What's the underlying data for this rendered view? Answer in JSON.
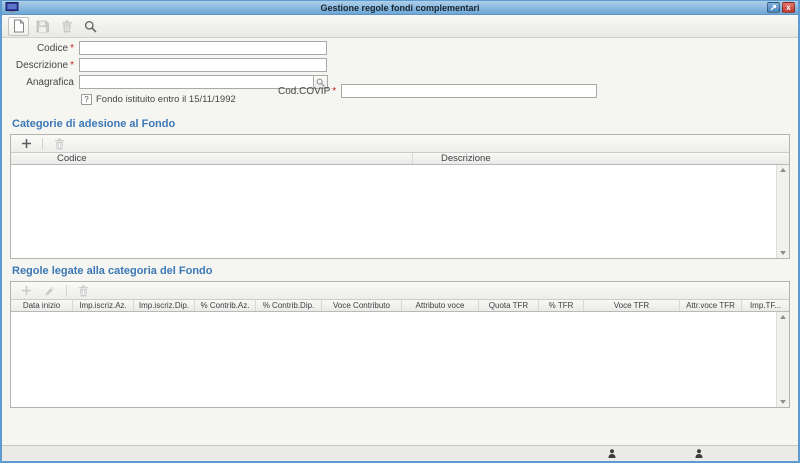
{
  "colors": {
    "accent_blue": "#3c78b4",
    "required_red": "#cc2222",
    "titlebar_blue": "#6ea6d6",
    "window_border": "#5e9bd1"
  },
  "window": {
    "title": "Gestione regole fondi complementari",
    "icon": "application-monitor-icon",
    "buttons": [
      "restore-window-icon",
      "close-window-icon"
    ],
    "close_glyph": "x"
  },
  "toolbar": {
    "buttons": [
      {
        "icon": "new-document-icon",
        "enabled": true
      },
      {
        "icon": "save-icon",
        "enabled": false
      },
      {
        "icon": "trash-icon",
        "enabled": false
      },
      {
        "icon": "search-icon",
        "enabled": true
      }
    ]
  },
  "form": {
    "required_marker": "*",
    "codice": {
      "label": "Codice",
      "value": ""
    },
    "descrizione": {
      "label": "Descrizione",
      "value": ""
    },
    "anagrafica": {
      "label": "Anagrafica",
      "value": "",
      "lookup_icon": "search-icon"
    },
    "fondo_checkbox": {
      "label": "Fondo istituito entro il 15/11/1992",
      "state": "indeterminate",
      "glyph": "?"
    },
    "cod_covip": {
      "label": "Cod.COVIP",
      "value": ""
    }
  },
  "categories_section": {
    "title": "Categorie di adesione al Fondo",
    "toolbar": {
      "add": {
        "icon": "plus-icon",
        "enabled": true
      },
      "delete": {
        "icon": "trash-icon",
        "enabled": false
      }
    },
    "columns": [
      "Codice",
      "Descrizione"
    ],
    "rows": []
  },
  "rules_section": {
    "title": "Regole legate alla categoria del Fondo",
    "toolbar": {
      "add": {
        "icon": "plus-icon",
        "enabled": false
      },
      "edit": {
        "icon": "pencil-icon",
        "enabled": false
      },
      "delete": {
        "icon": "trash-icon",
        "enabled": false
      }
    },
    "columns": [
      "Data inizio",
      "Imp.iscriz.Az.",
      "Imp.iscriz.Dip.",
      "% Contrib.Az.",
      "% Contrib.Dip.",
      "Voce Contributo",
      "Attributo voce",
      "Quota TFR",
      "% TFR",
      "Voce TFR",
      "Attr.voce TFR",
      "Imp.TF..."
    ],
    "rows": []
  },
  "statusbar": {
    "icons": [
      "user-icon",
      "user-icon"
    ]
  }
}
